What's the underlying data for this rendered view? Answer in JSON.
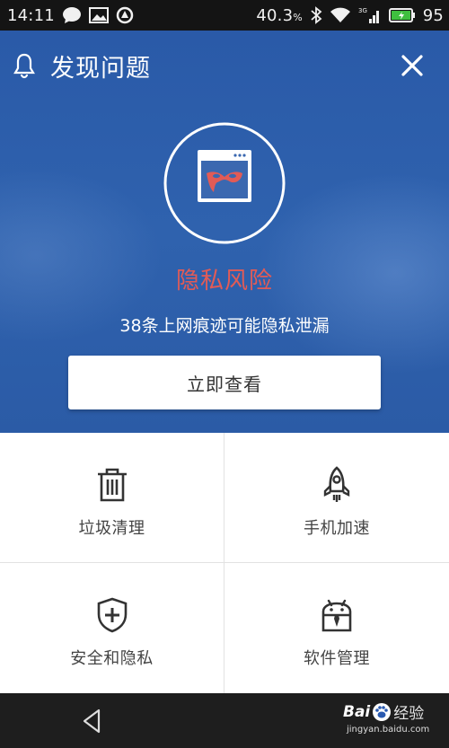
{
  "status_bar": {
    "time": "14:11",
    "battery_percent": "40.3",
    "percent_sign": "%",
    "battery_level": "95",
    "network": "3G"
  },
  "header": {
    "title": "发现问题"
  },
  "alert": {
    "title": "隐私风险",
    "description": "38条上网痕迹可能隐私泄漏",
    "action_label": "立即查看",
    "title_color": "#e25b56"
  },
  "tools": [
    {
      "label": "垃圾清理",
      "icon": "trash-icon"
    },
    {
      "label": "手机加速",
      "icon": "rocket-icon"
    },
    {
      "label": "安全和隐私",
      "icon": "shield-plus-icon"
    },
    {
      "label": "软件管理",
      "icon": "android-tie-icon"
    }
  ],
  "watermark": {
    "brand_left": "Bai",
    "brand_right": "经验",
    "url": "jingyan.baidu.com"
  },
  "colors": {
    "hero_blue": "#2f62ae",
    "accent_red": "#e25b56"
  }
}
